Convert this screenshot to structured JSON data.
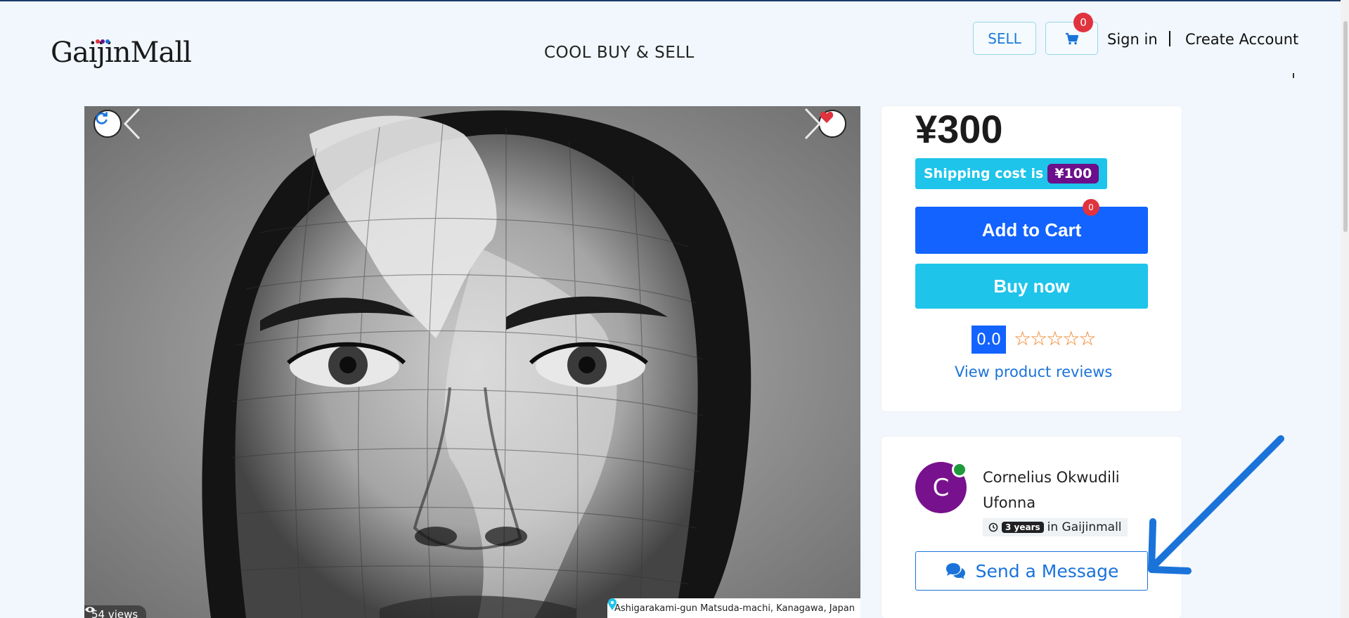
{
  "header": {
    "logo_text": "GaijinMall",
    "tagline": "COOL BUY & SELL",
    "sell_label": "SELL",
    "cart_count": "0",
    "signin_label": "Sign in",
    "create_account_label": "Create Account"
  },
  "gallery": {
    "views_text": "54 views",
    "location_text": "Ashigarakami-gun Matsuda-machi, Kanagawa, Japan",
    "refresh_icon": "refresh-icon",
    "favorite_icon": "heart-icon"
  },
  "product": {
    "price": "¥300",
    "shipping_label": "Shipping cost is",
    "shipping_amount": "¥100",
    "add_to_cart_label": "Add to Cart",
    "add_to_cart_badge": "0",
    "buy_now_label": "Buy now",
    "rating_value": "0.0",
    "stars": "☆☆☆☆☆",
    "reviews_link": "View product reviews"
  },
  "seller": {
    "avatar_initial": "C",
    "name": "Cornelius Okwudili Ufonna",
    "tenure_value": "3 years",
    "tenure_suffix": "in Gaijinmall",
    "message_label": "Send a Message"
  },
  "colors": {
    "primary_blue": "#1263ff",
    "cyan": "#1ec4ea",
    "purple": "#6b0f8a",
    "badge_red": "#e0333e",
    "annotation_arrow": "#1a73d9"
  }
}
